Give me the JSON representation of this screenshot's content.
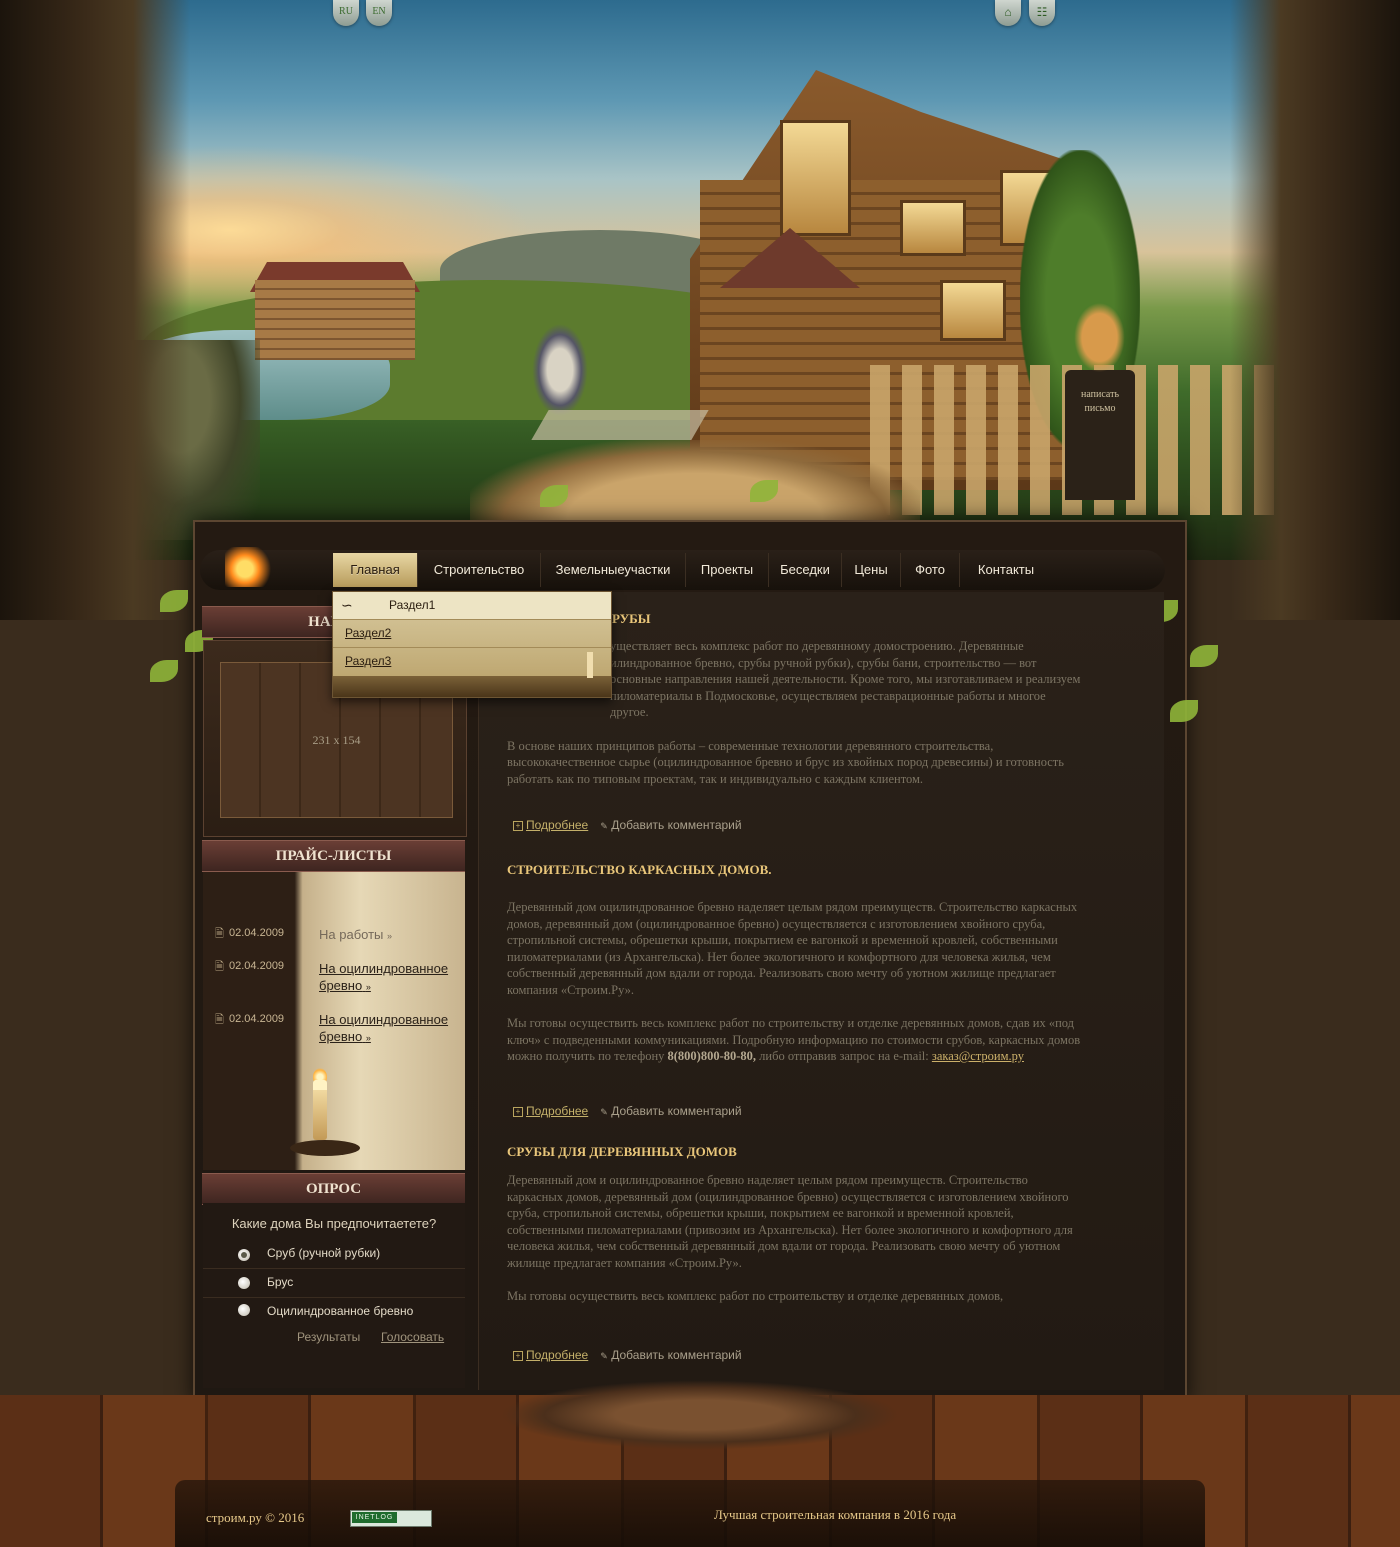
{
  "header": {
    "lang": [
      "RU",
      "EN"
    ],
    "top_icons": [
      "home-icon",
      "sitemap-icon"
    ],
    "mailbox_label": "написать письмо"
  },
  "nav": {
    "items": [
      "Главная",
      "Строительство",
      "Земельныеучастки",
      "Проекты",
      "Беседки",
      "Цены",
      "Фото",
      "Контакты"
    ],
    "active": "Главная",
    "dropdown": [
      "Раздел1",
      "Раздел2",
      "Раздел3"
    ]
  },
  "sidebar": {
    "our_works_title": "НАШИ",
    "photo_placeholder": "231 x 154",
    "price_title": "ПРАЙС-ЛИСТЫ",
    "price_items": [
      {
        "date": "02.04.2009",
        "label": "На работы",
        "link": false
      },
      {
        "date": "02.04.2009",
        "label": "На оцилиндрованное бревно",
        "link": true
      },
      {
        "date": "02.04.2009",
        "label": "На оцилиндрованное бревно",
        "link": true
      }
    ],
    "poll_title": "ОПРОС",
    "poll_question": "Какие дома Вы предпочитаетете?",
    "poll_options": [
      "Сруб (ручной рубки)",
      "Брус",
      "Оцилиндрованное бревно"
    ],
    "poll_selected": 0,
    "poll_results": "Результаты",
    "poll_vote": "Голосовать"
  },
  "content": {
    "articles": [
      {
        "title": "РУБЫ",
        "paragraphs": [
          "уществляет весь комплекс работ по деревянному домостроению. Деревянные илиндрованное бревно, срубы ручной рубки), срубы бани, строительство — вот основные направления нашей деятельности. Кроме того, мы изготавливаем и реализуем пиломатериалы в Подмосковье, осуществляем реставрационные работы и многое другое.",
          "В основе наших принципов работы – современные технологии деревянного строительства, высококачественное сырье (оцилиндрованное бревно и брус из хвойных пород древесины) и готовность работать как по типовым проектам, так и индивидуально с каждым клиентом."
        ]
      },
      {
        "title": "СТРОИТЕЛЬСТВО КАРКАСНЫХ ДОМОВ.",
        "paragraphs": [
          "Деревянный дом оцилиндрованное бревно наделяет целым рядом преимуществ. Строительство каркасных домов, деревянный дом (оцилиндрованное бревно) осуществляется с изготовлением хвойного сруба, стропильной системы, обрешетки крыши, покрытием ее вагонкой и временной кровлей, собственными пиломатериалами (из Архангельска). Нет более экологичного и комфортного для человека жилья, чем собственный деревянный дом вдали от города. Реализовать свою мечту об уютном жилище предлагает компания «Строим.Ру».",
          "Мы готовы осуществить весь комплекс работ по строительству и отделке деревянных домов, сдав их «под ключ» с подведенными коммуникациями. Подробную информацию по стоимости срубов, каркасных домов можно получить по телефону"
        ],
        "phone": "8(800)800-80-80,",
        "after_phone": "либо отправив запрос на e-mail:",
        "email": "заказ@строим.ру"
      },
      {
        "title": "СРУБЫ ДЛЯ ДЕРЕВЯННЫХ ДОМОВ",
        "paragraphs": [
          "Деревянный дом и оцилиндрованное бревно наделяет целым рядом преимуществ. Строительство каркасных домов, деревянный дом (оцилиндрованное бревно) осуществляется с изготовлением хвойного сруба, стропильной системы, обрешетки крыши, покрытием ее вагонкой и временной кровлей, собственными пиломатериалами (привозим из Архангельска). Нет более экологичного и комфортного для человека жилья, чем собственный деревянный дом вдали от города. Реализовать свою мечту об уютном жилище предлагает компания «Строим.Ру».",
          "Мы готовы осуществить весь комплекс работ по строительству и отделке деревянных домов,"
        ]
      }
    ],
    "more_label": "Подробнее",
    "comment_label": "Добавить комментарий"
  },
  "footer": {
    "copyright": "строим.ру © 2016",
    "counter_label": "INETLOG",
    "slogan": "Лучшая строительная компания в 2016 года"
  }
}
